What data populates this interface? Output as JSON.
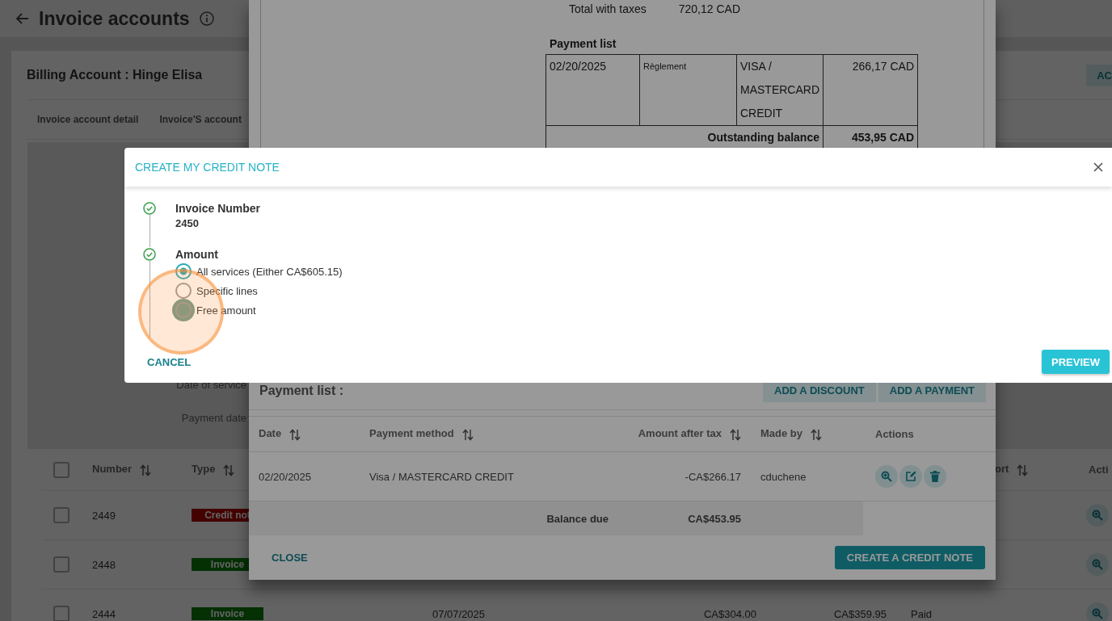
{
  "page": {
    "title": "Invoice accounts",
    "account_title": "Billing Account : Hinge Elisa",
    "account_button": "AC",
    "tabs": [
      "Invoice account detail",
      "Invoice'S account"
    ],
    "detail_labels": [
      "Date of service",
      "Payment date"
    ],
    "invoices": {
      "select_all_checked": false,
      "columns": [
        {
          "label": "Number",
          "sortable": true
        },
        {
          "label": "Type",
          "sortable": true
        },
        {
          "label": "ort",
          "sortable": true
        },
        {
          "label": "Acti",
          "sortable": false
        }
      ],
      "rows": [
        {
          "checked": false,
          "number": "2449",
          "type": {
            "label": "Credit not",
            "kind": "credit"
          }
        },
        {
          "checked": false,
          "number": "2448",
          "type": {
            "label": "Invoice",
            "kind": "invoice"
          }
        },
        {
          "checked": false,
          "number": "2444",
          "type": {
            "label": "Invoice",
            "kind": "invoice"
          },
          "column_3": "07/07/2025",
          "column_4": "CA$304.00",
          "column_5": "CA$359.95",
          "column_6": "Paid"
        }
      ]
    }
  },
  "invoice_modal": {
    "document": {
      "total_label": "Total with taxes",
      "total_value": "720,12 CAD",
      "payment_list_title": "Payment list",
      "payments": [
        {
          "date": "02/20/2025",
          "type": "Règlement",
          "method": "VISA / MASTERCARD CREDIT",
          "amount": "266,17 CAD"
        }
      ],
      "balance_label": "Outstanding balance",
      "balance_value": "453,95 CAD"
    },
    "payment_list_title": "Payment list :",
    "buttons": [
      "ADD A DISCOUNT",
      "ADD A PAYMENT"
    ],
    "columns": [
      {
        "label": "Date",
        "sortable": true
      },
      {
        "label": "Payment method",
        "sortable": true
      },
      {
        "label": "Amount after tax",
        "sortable": true
      },
      {
        "label": "Made by",
        "sortable": true
      },
      {
        "label": "Actions",
        "sortable": false
      }
    ],
    "payments": [
      {
        "date": "02/20/2025",
        "method": "Visa / MASTERCARD CREDIT",
        "amount": "-CA$266.17",
        "made_by": "cduchene"
      }
    ],
    "balance_label": "Balance due",
    "balance_value": "CA$453.95",
    "close_label": "CLOSE",
    "create_label": "CREATE A CREDIT NOTE"
  },
  "credit_note_dialog": {
    "title": "CREATE MY CREDIT NOTE",
    "steps": [
      {
        "label": "Invoice Number",
        "value": "2450",
        "completed": true
      },
      {
        "label": "Amount",
        "completed": true,
        "options": [
          {
            "label": "All services (Either CA$605.15)",
            "selected": true,
            "focused": false
          },
          {
            "label": "Specific lines",
            "selected": false,
            "focused": false
          },
          {
            "label": "Free amount",
            "selected": false,
            "focused": true
          }
        ]
      }
    ],
    "cancel_label": "CANCEL",
    "preview_label": "PREVIEW"
  },
  "click_highlight": true
}
